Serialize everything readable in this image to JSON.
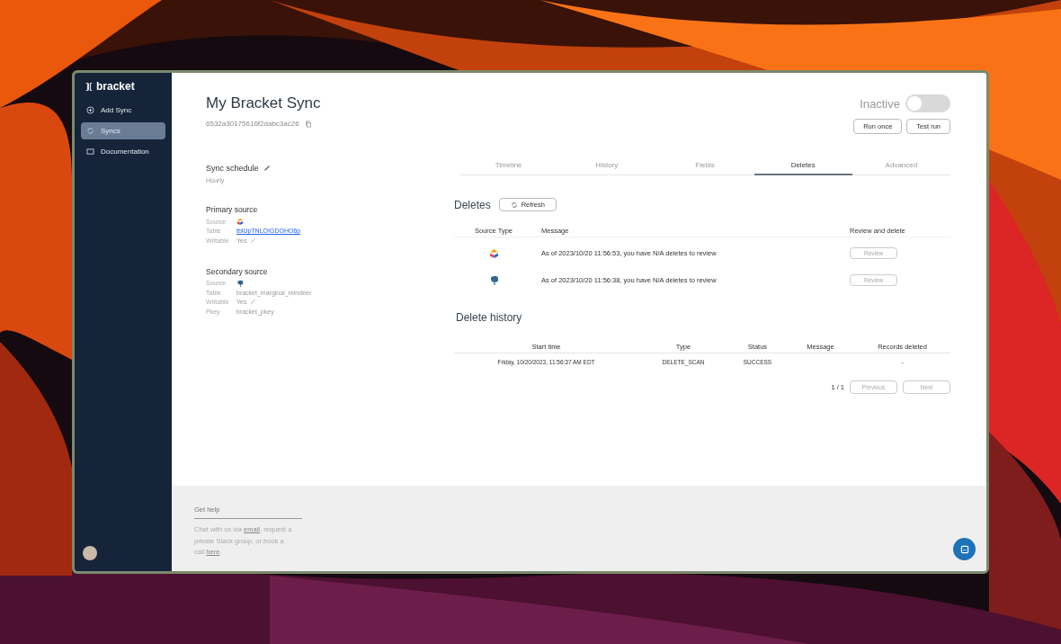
{
  "sidebar": {
    "logo": "bracket",
    "items": [
      {
        "label": "Add Sync",
        "kind": "plus",
        "selected": false
      },
      {
        "label": "Syncs",
        "kind": "sync",
        "selected": true
      },
      {
        "label": "Documentation",
        "kind": "book",
        "selected": false
      }
    ]
  },
  "header": {
    "title": "My Bracket Sync",
    "id": "6532a30175616f2dabc3ac26",
    "status": {
      "label": "Inactive",
      "on": false
    },
    "buttons": [
      "Run once",
      "Test run"
    ]
  },
  "details": {
    "schedule": {
      "title": "Sync schedule",
      "value": "Hourly"
    },
    "sources": [
      {
        "title": "Primary source",
        "rows": [
          {
            "label": "Source",
            "kind": "spreadsheet"
          },
          {
            "label": "Table",
            "kind": "link",
            "value": "tblUpTNLOIGDOHO6p"
          },
          {
            "label": "Writable",
            "kind": "editable",
            "value": "Yes"
          }
        ]
      },
      {
        "title": "Secondary source",
        "rows": [
          {
            "label": "Source",
            "kind": "database"
          },
          {
            "label": "Table",
            "kind": "text",
            "value": "bracket_marginal_reindeer"
          },
          {
            "label": "Writable",
            "kind": "editable",
            "value": "Yes"
          },
          {
            "label": "Pkey",
            "kind": "text",
            "value": "bracket_pkey"
          }
        ]
      }
    ]
  },
  "tabs": [
    {
      "label": "Timeline",
      "selected": false
    },
    {
      "label": "History",
      "selected": false
    },
    {
      "label": "Fields",
      "selected": false
    },
    {
      "label": "Deletes",
      "selected": true
    },
    {
      "label": "Advanced",
      "selected": false
    }
  ],
  "deletes": {
    "title": "Deletes",
    "refresh": "Refresh",
    "columns": [
      "Source Type",
      "Message",
      "Review and delete"
    ],
    "rows": [
      {
        "kind": "spreadsheet",
        "message": "As of 2023/10/20 11:56:53, you have N/A deletes to review",
        "action": "Review",
        "disabled": true
      },
      {
        "kind": "database",
        "message": "As of 2023/10/20 11:56:38, you have N/A deletes to review",
        "action": "Review",
        "disabled": true
      }
    ]
  },
  "history": {
    "title": "Delete history",
    "columns": [
      "Start time",
      "Type",
      "Status",
      "Message",
      "Records deleted"
    ],
    "rows": [
      [
        "Friday, 10/20/2023, 11:56:37 AM EDT",
        "DELETE_SCAN",
        "SUCCESS",
        "",
        "-"
      ]
    ],
    "page": "1 / 1",
    "pager": [
      {
        "label": "Previous",
        "disabled": true
      },
      {
        "label": "Next",
        "disabled": true
      }
    ]
  },
  "help": {
    "title": "Get help",
    "before": "Chat with us via ",
    "link1": "email",
    "middle": ", request a private Slack group, or book a call ",
    "link2": "here",
    "after": "."
  }
}
